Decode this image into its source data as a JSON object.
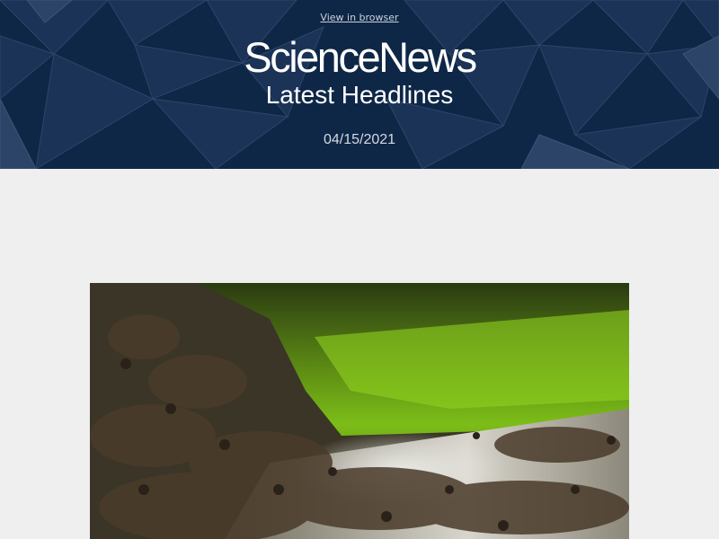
{
  "header": {
    "view_in_browser": "View in browser",
    "logo": "ScienceNews",
    "title": "Latest Headlines",
    "date": "04/15/2021"
  },
  "colors": {
    "header_bg": "#0f2747",
    "page_bg": "#efefef",
    "text_white": "#ffffff"
  },
  "hero": {
    "subject": "wildebeest herd crossing a river"
  }
}
